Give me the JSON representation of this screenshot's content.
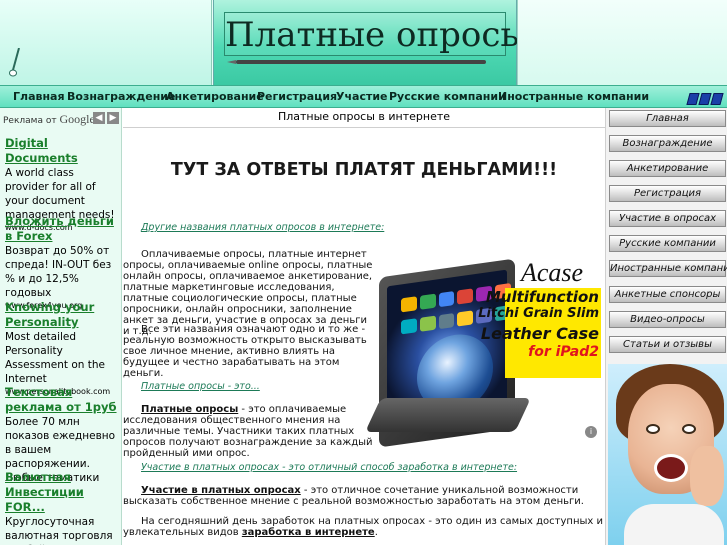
{
  "site": {
    "title": "Платные опросы"
  },
  "topnav": [
    {
      "label": "Главная"
    },
    {
      "label": "Вознаграждение"
    },
    {
      "label": "Анкетирование"
    },
    {
      "label": "Регистрация"
    },
    {
      "label": "Участие"
    },
    {
      "label": "Русские компании"
    },
    {
      "label": "Иностранные компании"
    }
  ],
  "ads": {
    "by_label": "Реклама от",
    "google_label": "Google",
    "items": [
      {
        "title": "Digital Documents",
        "text": "A world class provider for all of your document management needs!",
        "url": "www.d-docs.com"
      },
      {
        "title": "Вложить деньги в Forex",
        "text": "Возврат до 50% от спреда! IN-OUT без % и до 12,5% годовых",
        "url": "www.forex4you.org"
      },
      {
        "title": "Knowing your Personality",
        "text": "Most detailed Personality Assessment on the Internet",
        "url": "www.personalitybook.com"
      },
      {
        "title": "Текстовая реклама от 1руб",
        "text": "Более 70 млн показов ежедневно в вашем распоряжении. Любые тематики",
        "url": ""
      },
      {
        "title": "Валютная Инвестиции FOR...",
        "text": "Круглосуточная валютная торговля Пробуйте сегодня с",
        "url": ""
      }
    ]
  },
  "main": {
    "header": "Платные опросы в интернете",
    "headline": "ТУТ ЗА ОТВЕТЫ ПЛАТЯТ ДЕНЬГАМИ!!!",
    "link1": "Другие названия платных опросов в интернете:",
    "para1": "Оплачиваемые опросы, платные интернет опросы, оплачиваемые online опросы, платные онлайн опросы, оплачиваемое анкетирование, платные маркетинговые исследования, платные социологические опросы, платные опросники, онлайн опросники, заполнение анкет за деньги, участие в опросах за деньги и т.д.",
    "para2": "Все эти названия означают одно и то же - реальную возможность открыто высказывать свое личное мнение, активно влиять на будущее и честно зарабатывать на этом деньги.",
    "link2": "Платные опросы - это...",
    "para3_term": "Платные опросы",
    "para3": " - это оплачиваемые исследования общественного мнения на различные темы. Участники таких платных опросов получают вознаграждение за каждый пройденный ими опрос.",
    "link3": "Участие в платных опросах - это отличный способ заработка в интернете:",
    "para4_term": "Участие в платных опросах",
    "para4": " - это отличное сочетание уникальной возможности высказать собственное мнение с реальной возможностью заработать на этом деньги.",
    "para5": "На сегодняшний день заработок на платных опросах - это один из самых доступных и увлекательных видов ",
    "para5_term": "заработка в интернете",
    "para5_end": "."
  },
  "ipad_ad": {
    "brand": "Acase",
    "line1": "Multifunction",
    "line2": "Litchi Grain Slim",
    "line3": "Leather Case",
    "line4": "for iPad2",
    "red_color": "#e0141e",
    "bg_color": "#ffe800"
  },
  "rightnav": [
    {
      "label": "Главная"
    },
    {
      "label": "Вознаграждение"
    },
    {
      "label": "Анкетирование"
    },
    {
      "label": "Регистрация"
    },
    {
      "label": "Участие в опросах"
    },
    {
      "label": "Русские компании"
    },
    {
      "label": "Иностранные компании"
    },
    {
      "label": "Анкетные спонсоры"
    },
    {
      "label": "Видео-опросы"
    },
    {
      "label": "Статьи и отзывы"
    }
  ],
  "colors": {
    "accent": "#5fe0bf",
    "link": "#1d7a57",
    "ad_title": "#1a7f2c"
  }
}
